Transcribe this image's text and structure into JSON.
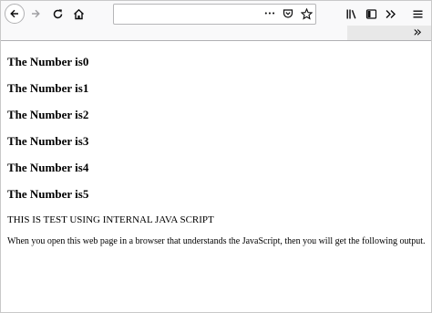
{
  "browser": {
    "toolbar": {
      "back_icon": "back-arrow-icon",
      "forward_icon": "forward-arrow-icon",
      "reload_icon": "reload-icon",
      "home_icon": "home-icon",
      "address_value": "",
      "page_actions": [
        "more-actions-icon",
        "pocket-icon",
        "bookmark-star-icon"
      ],
      "right_icons": [
        "library-icon",
        "sidebar-icon",
        "overflow-chevron-icon",
        "hamburger-menu-icon"
      ],
      "page_actions_glyph": "•••"
    },
    "bookmarks_bar": {
      "overflow_glyph": "»"
    }
  },
  "page": {
    "numbers": [
      "The Number is0",
      "The Number is1",
      "The Number is2",
      "The Number is3",
      "The Number is4",
      "The Number is5"
    ],
    "test_line": "THIS IS TEST USING INTERNAL JAVA SCRIPT",
    "paragraph": "When you open this web page in a browser that understands the JavaScript, then you will get the following output."
  },
  "colors": {
    "toolbar_bg": "#f9f9fa",
    "icon": "#0c0c0d",
    "border": "#b1b1b3",
    "page_bg": "#ffffff"
  }
}
